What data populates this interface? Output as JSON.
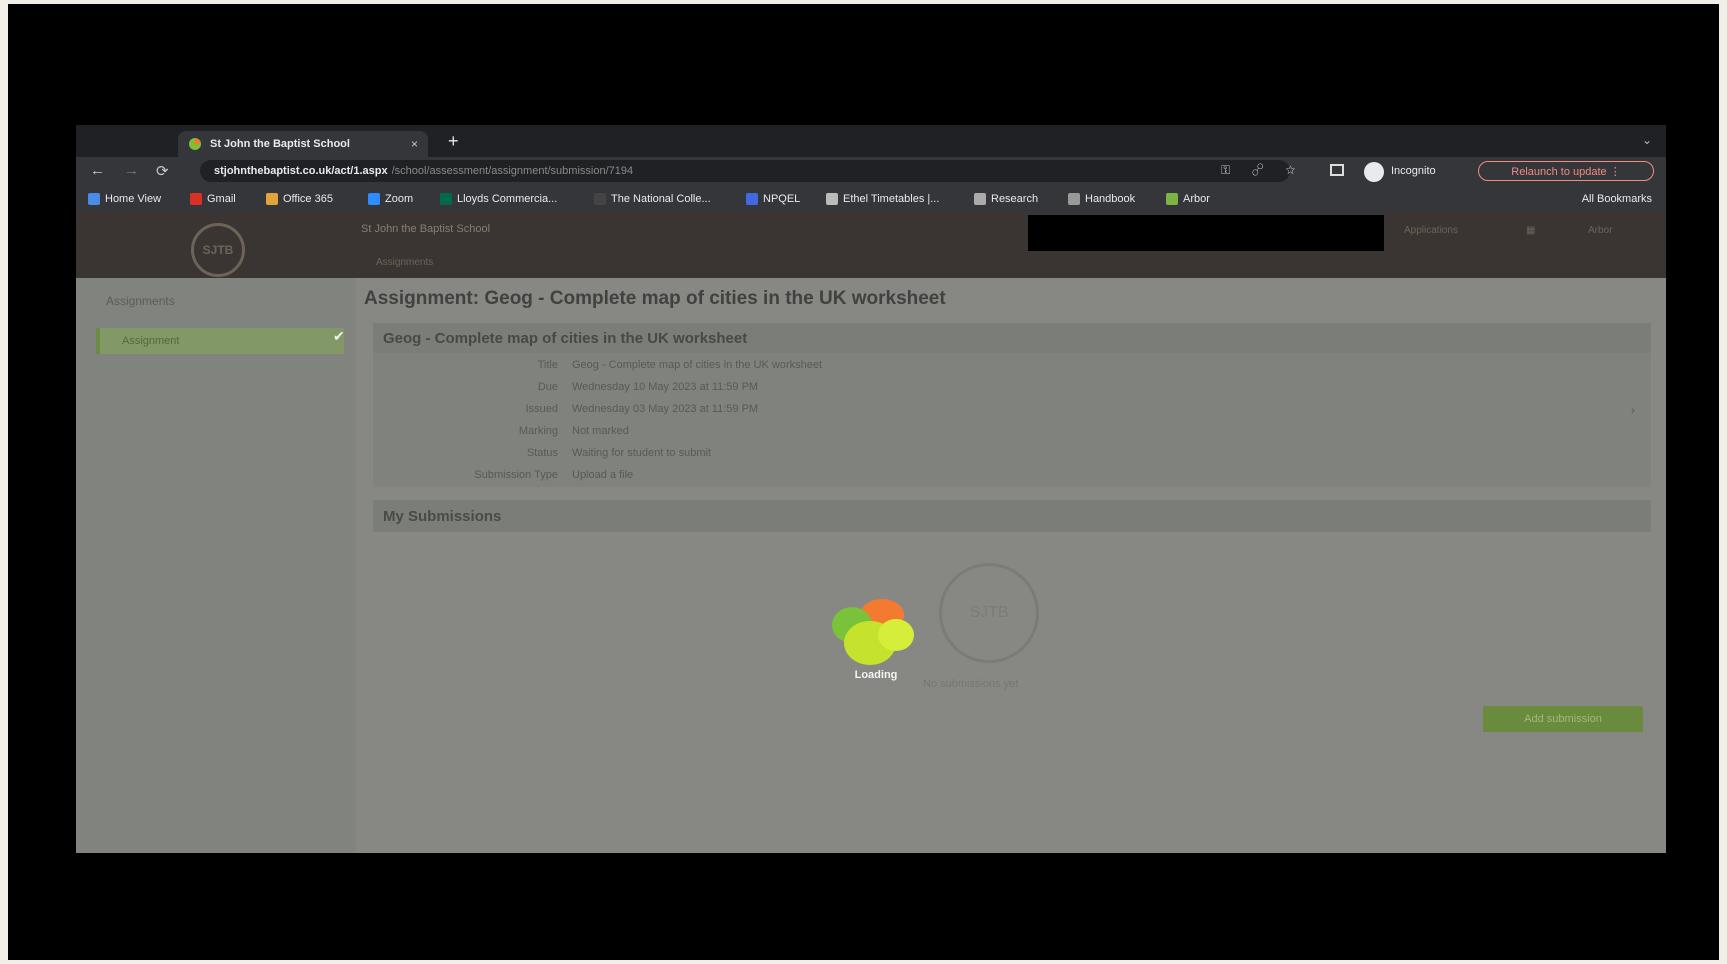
{
  "browser": {
    "tab_title": "St John the Baptist School",
    "tab_close": "×",
    "new_tab": "+",
    "tab_menu": "⌄",
    "url_host": "stjohnthebaptist.co.uk/act/1.aspx",
    "url_path": "/school/assessment/assignment/submission/7194",
    "profile_label": "Incognito",
    "update_label": "Relaunch to update ⋮",
    "bookmarks": [
      {
        "label": "Home View",
        "color": "#4a8be8"
      },
      {
        "label": "Gmail",
        "color": "#d93025"
      },
      {
        "label": "Office 365",
        "color": "#e2a33a"
      },
      {
        "label": "Zoom",
        "color": "#2d8cff"
      },
      {
        "label": "Lloyds Commercia...",
        "color": "#006a4d"
      },
      {
        "label": "The National Colle...",
        "color": "#444444"
      },
      {
        "label": "NPQEL",
        "color": "#4169e1"
      },
      {
        "label": "Ethel Timetables |...",
        "color": "#bbbbbb"
      },
      {
        "label": "Research",
        "color": "#aaaaaa"
      },
      {
        "label": "Handbook",
        "color": "#999999"
      },
      {
        "label": "Arbor",
        "color": "#7cb342"
      }
    ],
    "all_bookmarks": "All Bookmarks"
  },
  "app": {
    "logo_text": "SJTB",
    "school_name": "St John the Baptist School",
    "school_sub": "Assignments",
    "header_buttons": [
      "Applications",
      "▦",
      "Arbor"
    ],
    "sidebar": {
      "top_item": "Assignments",
      "active_item": "Assignment",
      "check": "✔"
    },
    "page_title": "Assignment: Geog - Complete map of cities in the UK worksheet",
    "card": {
      "title": "Geog - Complete map of cities in the UK worksheet",
      "rows": [
        {
          "label": "Title",
          "value": "Geog - Complete map of cities in the UK worksheet"
        },
        {
          "label": "Due",
          "value": "Wednesday 10 May 2023 at 11:59 PM"
        },
        {
          "label": "Issued",
          "value": "Wednesday 03 May 2023 at 11:59 PM"
        },
        {
          "label": "Marking",
          "value": "Not marked"
        },
        {
          "label": "Status",
          "value": "Waiting for student to submit"
        },
        {
          "label": "Submission Type",
          "value": "Upload a file"
        }
      ],
      "arrow": "›"
    },
    "submissions": {
      "title": "My Submissions",
      "empty_logo": "SJTB",
      "empty_text": "No submissions yet",
      "add_button": "Add submission"
    },
    "loading_label": "Loading"
  },
  "colors": {
    "loader_orange": "#f47a30",
    "loader_green": "#79c23a",
    "loader_lime": "#c5e32d"
  }
}
